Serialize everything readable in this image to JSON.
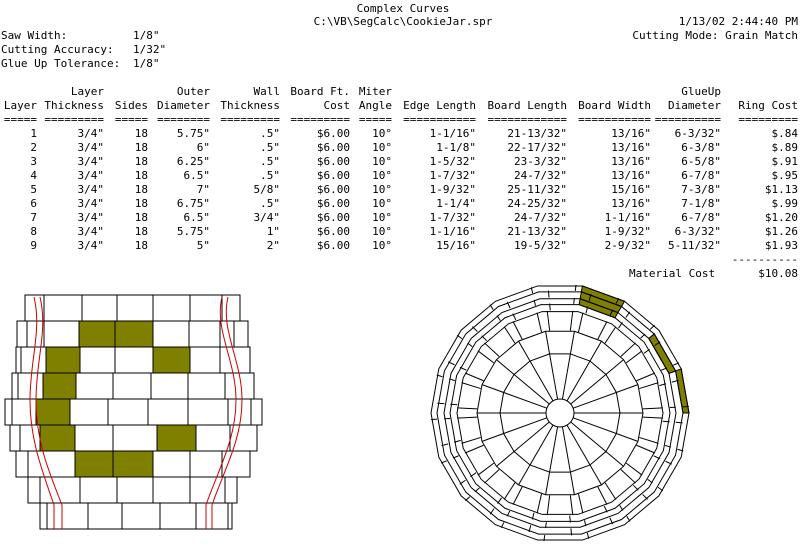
{
  "header": {
    "title": "Complex Curves",
    "file_path": "C:\\VB\\SegCalc\\CookieJar.spr",
    "date_time": "1/13/02 2:44:40 PM",
    "saw_width_label": "Saw Width:",
    "saw_width": "1/8\"",
    "cutting_accuracy_label": "Cutting Accuracy:",
    "cutting_accuracy": "1/32\"",
    "glue_up_tolerance_label": "Glue Up Tolerance:",
    "glue_up_tolerance": "1/8\"",
    "cutting_mode": "Cutting Mode: Grain Match"
  },
  "table": {
    "header_row1": [
      "",
      "Layer",
      "",
      "Outer",
      "Wall",
      "Board Ft.",
      "Miter",
      "",
      "",
      "",
      "GlueUp",
      ""
    ],
    "header_row2": [
      "Layer",
      "Thickness",
      "Sides",
      "Diameter",
      "Thickness",
      "Cost",
      "Angle",
      "Edge Length",
      "Board Length",
      "Board Width",
      "Diameter",
      "Ring Cost"
    ],
    "rule_row": [
      "=====",
      "=========",
      "=====",
      "========",
      "=========",
      "=========",
      "=====",
      "===========",
      "============",
      "===========",
      "==========",
      "========="
    ],
    "rows": [
      [
        "1",
        "3/4\"",
        "18",
        "5.75\"",
        ".5\"",
        "$6.00",
        "10°",
        "1-1/16\"",
        "21-13/32\"",
        "13/16\"",
        "6-3/32\"",
        "$.84"
      ],
      [
        "2",
        "3/4\"",
        "18",
        "6\"",
        ".5\"",
        "$6.00",
        "10°",
        "1-1/8\"",
        "22-17/32\"",
        "13/16\"",
        "6-3/8\"",
        "$.89"
      ],
      [
        "3",
        "3/4\"",
        "18",
        "6.25\"",
        ".5\"",
        "$6.00",
        "10°",
        "1-5/32\"",
        "23-3/32\"",
        "13/16\"",
        "6-5/8\"",
        "$.91"
      ],
      [
        "4",
        "3/4\"",
        "18",
        "6.5\"",
        ".5\"",
        "$6.00",
        "10°",
        "1-7/32\"",
        "24-7/32\"",
        "13/16\"",
        "6-7/8\"",
        "$.95"
      ],
      [
        "5",
        "3/4\"",
        "18",
        "7\"",
        "5/8\"",
        "$6.00",
        "10°",
        "1-9/32\"",
        "25-11/32\"",
        "15/16\"",
        "7-3/8\"",
        "$1.13"
      ],
      [
        "6",
        "3/4\"",
        "18",
        "6.75\"",
        ".5\"",
        "$6.00",
        "10°",
        "1-1/4\"",
        "24-25/32\"",
        "13/16\"",
        "7-1/8\"",
        "$.99"
      ],
      [
        "7",
        "3/4\"",
        "18",
        "6.5\"",
        "3/4\"",
        "$6.00",
        "10°",
        "1-7/32\"",
        "24-7/32\"",
        "1-1/16\"",
        "6-7/8\"",
        "$1.20"
      ],
      [
        "8",
        "3/4\"",
        "18",
        "5.75\"",
        "1\"",
        "$6.00",
        "10°",
        "1-1/16\"",
        "21-13/32\"",
        "1-9/32\"",
        "6-3/32\"",
        "$1.26"
      ],
      [
        "9",
        "3/4\"",
        "18",
        "5\"",
        "2\"",
        "$6.00",
        "10°",
        "15/16\"",
        "19-5/32\"",
        "2-9/32\"",
        "5-11/32\"",
        "$1.93"
      ]
    ],
    "total_rule": "----------",
    "material_cost_label": "Material Cost",
    "material_cost": "$10.08"
  },
  "colors": {
    "accent_segment": "#808000",
    "profile_line": "#cc0000"
  }
}
